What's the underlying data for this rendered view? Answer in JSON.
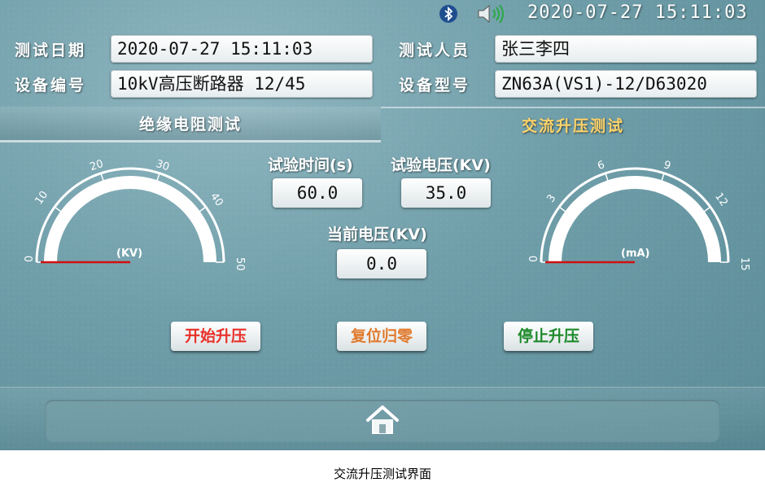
{
  "status_bar": {
    "datetime": "2020-07-27 15:11:03",
    "bluetooth_icon": "bluetooth-icon",
    "speaker_icon": "speaker-icon"
  },
  "info": {
    "test_date_label": "测试日期",
    "test_date_value": "2020-07-27 15:11:03",
    "tester_label": "测试人员",
    "tester_value": "张三李四",
    "device_no_label": "设备编号",
    "device_no_value": "10kV高压断路器 12/45",
    "device_model_label": "设备型号",
    "device_model_value": "ZN63A(VS1)-12/D63020"
  },
  "tabs": {
    "insulation": "绝缘电阻测试",
    "ac_boost": "交流升压测试"
  },
  "left_gauge": {
    "unit": "(KV)",
    "ticks": [
      "0",
      "10",
      "20",
      "30",
      "40",
      "50"
    ],
    "min": 0,
    "max": 50,
    "value": 0
  },
  "right_gauge": {
    "unit": "(mA)",
    "ticks": [
      "0",
      "3",
      "6",
      "9",
      "12",
      "15"
    ],
    "min": 0,
    "max": 15,
    "value": 0
  },
  "readings": {
    "test_time_label": "试验时间(s)",
    "test_time_value": "60.0",
    "test_voltage_label": "试验电压(KV)",
    "test_voltage_value": "35.0",
    "current_voltage_label": "当前电压(KV)",
    "current_voltage_value": "0.0"
  },
  "buttons": {
    "start": "开始升压",
    "reset": "复位归零",
    "stop": "停止升压"
  },
  "colors": {
    "start": "#e8302a",
    "reset": "#e07a2e",
    "stop": "#1c8a2a",
    "active_tab": "#ffd46a",
    "needle": "#d01010"
  },
  "home_icon": "home-icon",
  "caption": "交流升压测试界面"
}
